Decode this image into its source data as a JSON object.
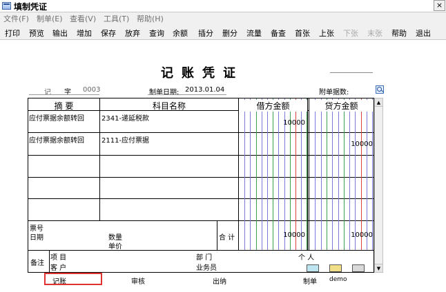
{
  "window": {
    "title": "填制凭证",
    "close_glyph": "×"
  },
  "menu": {
    "items": [
      {
        "label": "文件(F)"
      },
      {
        "label": "制单(E)"
      },
      {
        "label": "查看(V)"
      },
      {
        "label": "工具(T)"
      },
      {
        "label": "帮助(H)"
      }
    ]
  },
  "toolbar": {
    "items": [
      {
        "label": "打印",
        "enabled": true
      },
      {
        "label": "预览",
        "enabled": true
      },
      {
        "label": "输出",
        "enabled": true
      },
      {
        "label": "增加",
        "enabled": true
      },
      {
        "label": "保存",
        "enabled": true
      },
      {
        "label": "放弃",
        "enabled": true
      },
      {
        "label": "查询",
        "enabled": true
      },
      {
        "label": "余额",
        "enabled": true
      },
      {
        "label": "插分",
        "enabled": true
      },
      {
        "label": "删分",
        "enabled": true
      },
      {
        "label": "流量",
        "enabled": true
      },
      {
        "label": "备查",
        "enabled": true
      },
      {
        "label": "首张",
        "enabled": true
      },
      {
        "label": "上张",
        "enabled": true
      },
      {
        "label": "下张",
        "enabled": false
      },
      {
        "label": "末张",
        "enabled": false
      },
      {
        "label": "帮助",
        "enabled": true
      },
      {
        "label": "退出",
        "enabled": true
      }
    ]
  },
  "voucher": {
    "title": "记账凭证",
    "word_type": "记",
    "word_label": "字",
    "number": "0003",
    "date_label": "制单日期:",
    "date": "2013.01.04",
    "attachments_label": "附单据数:",
    "attachments_value": ""
  },
  "table": {
    "headers": {
      "summary": "摘 要",
      "account": "科目名称",
      "debit": "借方金额",
      "credit": "贷方金额"
    },
    "rows": [
      {
        "summary": "应付票据余额转回",
        "account": "2341-递延税款",
        "debit": "10000",
        "credit": ""
      },
      {
        "summary": "应付票据余额转回",
        "account": "2111-应付票据",
        "debit": "",
        "credit": "10000"
      },
      {
        "summary": "",
        "account": "",
        "debit": "",
        "credit": ""
      },
      {
        "summary": "",
        "account": "",
        "debit": "",
        "credit": ""
      },
      {
        "summary": "",
        "account": "",
        "debit": "",
        "credit": ""
      }
    ],
    "footer": {
      "bill_no_label": "票号",
      "date_label": "日期",
      "quantity_label": "数量",
      "unit_price_label": "单价",
      "total_label": "合 计",
      "debit_total": "10000",
      "credit_total": "10000"
    },
    "remarks": {
      "label": "备注",
      "project_label": "项 目",
      "customer_label": "客 户",
      "department_label": "部 门",
      "person_label": "个 人",
      "salesperson_label": "业务员"
    }
  },
  "signatures": {
    "posting_label": "记账",
    "review_label": "审核",
    "cashier_label": "出纳",
    "maker_label": "制单",
    "maker_value": "demo"
  },
  "colors": {
    "grid_blue": "#7a7ae0",
    "grid_red": "#d84040",
    "grid_green": "#3aa050",
    "highlight": "#e03030"
  },
  "icons": {
    "window": "app-icon",
    "close": "close-icon",
    "attachments": "search-icon",
    "remark_1": "card-icon",
    "remark_2": "folder-icon",
    "remark_3": "tools-icon",
    "scroll_up": "scroll-up-icon",
    "scroll_down": "scroll-down-icon"
  }
}
